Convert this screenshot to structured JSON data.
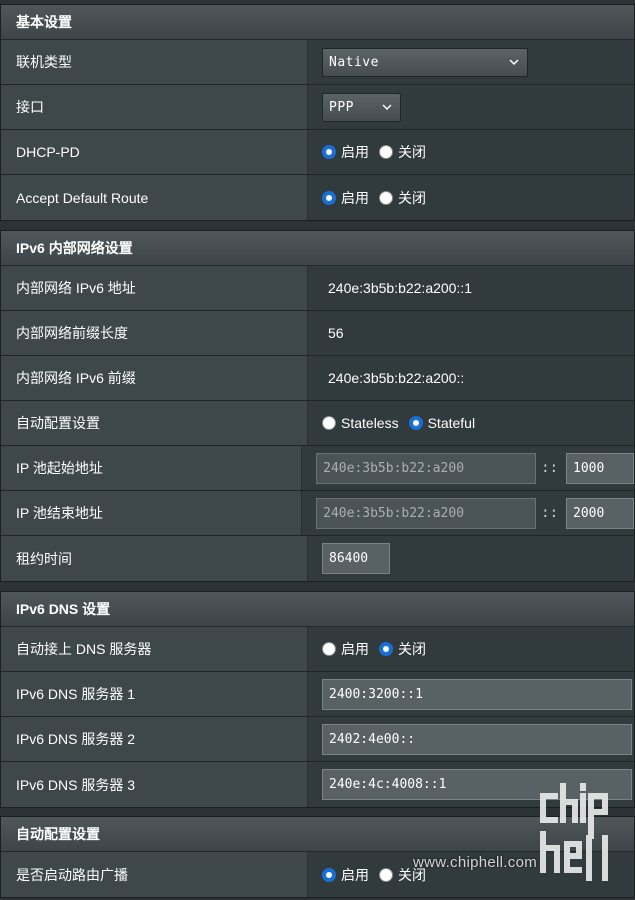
{
  "basic": {
    "header": "基本设置",
    "conn_type_label": "联机类型",
    "conn_type_value": "Native",
    "interface_label": "接口",
    "interface_value": "PPP",
    "dhcppd_label": "DHCP-PD",
    "dhcppd_enable": "启用",
    "dhcppd_disable": "关闭",
    "adr_label": "Accept Default Route",
    "adr_enable": "启用",
    "adr_disable": "关闭"
  },
  "lan": {
    "header": "IPv6 内部网络设置",
    "addr_label": "内部网络 IPv6 地址",
    "addr_value": "240e:3b5b:b22:a200::1",
    "prefix_len_label": "内部网络前缀长度",
    "prefix_len_value": "56",
    "prefix_label": "内部网络 IPv6 前缀",
    "prefix_value": "240e:3b5b:b22:a200::",
    "autoconf_label": "自动配置设置",
    "autoconf_stateless": "Stateless",
    "autoconf_stateful": "Stateful",
    "pool_start_label": "IP 池起始地址",
    "pool_start_prefix": "240e:3b5b:b22:a200",
    "pool_start_suffix": "1000",
    "pool_end_label": "IP 池结束地址",
    "pool_end_prefix": "240e:3b5b:b22:a200",
    "pool_end_suffix": "2000",
    "lease_label": "租约时间",
    "lease_value": "86400",
    "colon": "::"
  },
  "dns": {
    "header": "IPv6 DNS 设置",
    "auto_label": "自动接上 DNS 服务器",
    "auto_enable": "启用",
    "auto_disable": "关闭",
    "dns1_label": "IPv6 DNS 服务器 1",
    "dns1_value": "2400:3200::1",
    "dns2_label": "IPv6 DNS 服务器 2",
    "dns2_value": "2402:4e00::",
    "dns3_label": "IPv6 DNS 服务器 3",
    "dns3_value": "240e:4c:4008::1"
  },
  "ra": {
    "header": "自动配置设置",
    "broadcast_label": "是否启动路由广播",
    "broadcast_enable": "启用",
    "broadcast_disable": "关闭"
  },
  "watermark": {
    "url": "www.chiphell.com",
    "logo_text": "chip hell"
  },
  "colors": {
    "radio_selected": "#1a6fd6",
    "label_bg": "#3e474a",
    "value_bg": "#313a3d"
  }
}
